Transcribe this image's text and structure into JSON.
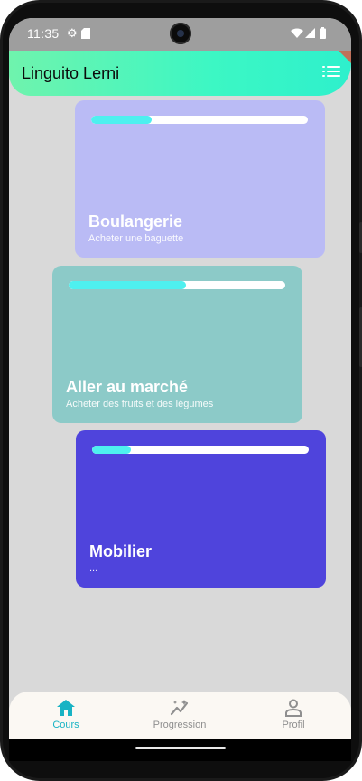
{
  "status_bar": {
    "time": "11:35"
  },
  "app_bar": {
    "title": "Linguito Lerni"
  },
  "colors": {
    "progress_fill": "#4ef0ef",
    "nav_active": "#18b3c4",
    "nav_inactive": "#8f8f8f"
  },
  "lessons": [
    {
      "title": "Boulangerie",
      "subtitle": "Acheter une baguette",
      "progress": 0.28,
      "color": "#babbf5"
    },
    {
      "title": "Aller au marché",
      "subtitle": "Acheter des fruits et des légumes",
      "progress": 0.54,
      "color": "#8ccac8"
    },
    {
      "title": "Mobilier",
      "subtitle": "...",
      "progress": 0.18,
      "color": "#4f44dc"
    }
  ],
  "bottom_nav": {
    "items": [
      {
        "label": "Cours",
        "icon": "home-icon",
        "active": true
      },
      {
        "label": "Progression",
        "icon": "chart-sparkle-icon",
        "active": false
      },
      {
        "label": "Profil",
        "icon": "person-icon",
        "active": false
      }
    ]
  }
}
